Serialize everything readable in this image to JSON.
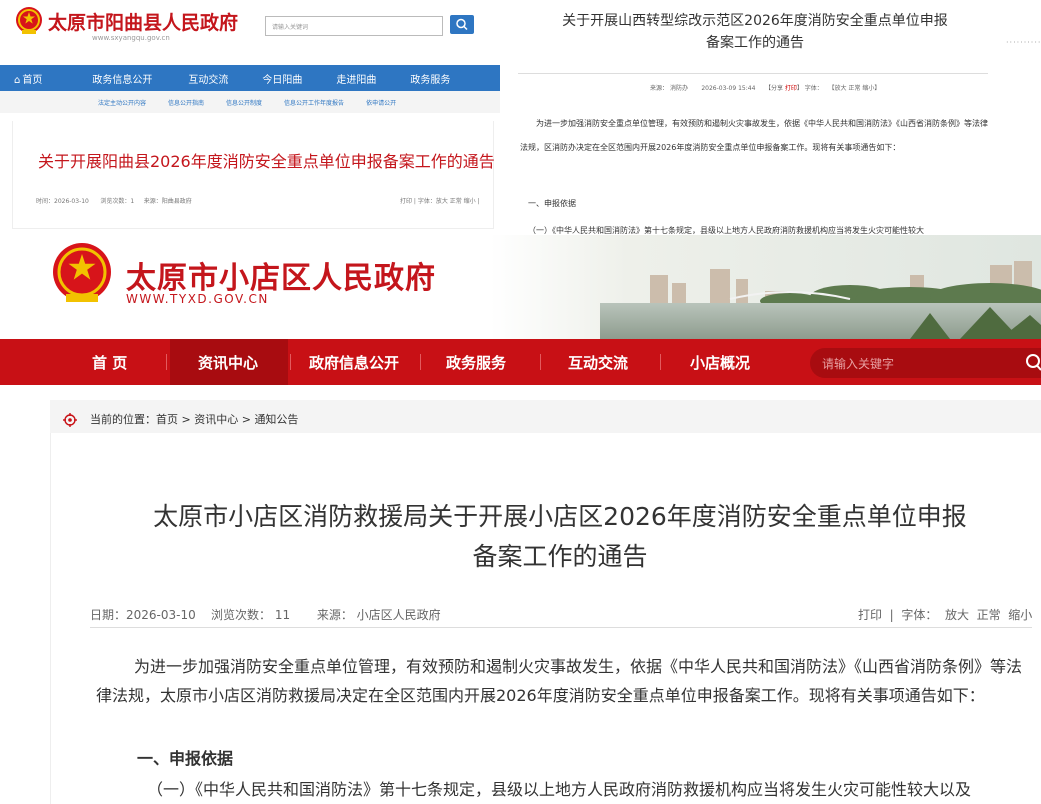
{
  "panelA": {
    "site_title": "太原市阳曲县人民政府",
    "site_url": "www.sxyangqu.gov.cn",
    "search_placeholder": "请输入关键词",
    "nav": [
      "首页",
      "政务信息公开",
      "互动交流",
      "今日阳曲",
      "走进阳曲",
      "政务服务"
    ],
    "subnav": [
      "法定主动公开内容",
      "信息公开指南",
      "信息公开制度",
      "信息公开工作年度报告",
      "依申请公开"
    ],
    "article_title": "关于开展阳曲县2026年度消防安全重点单位申报备案工作的通告",
    "meta": {
      "date": "时间：2026-03-10",
      "views": "浏览次数：1",
      "source": "来源：阳曲县政府"
    },
    "meta_right": "打印 | 字体：放大 正常 缩小 |",
    "colors": {
      "primary": "#2e76c2",
      "title": "#c4161c"
    }
  },
  "panelB": {
    "title_line1": "关于开展山西转型综改示范区2026年度消防安全重点单位申报",
    "title_line2": "备案工作的通告",
    "meta_source": "来源：",
    "meta_source_val": "消防办",
    "meta_date": "2026-03-09 15:44",
    "meta_print": "【分享",
    "meta_print_red": "打印",
    "meta_print_end": "】 字体：",
    "meta_font": "【放大 正常 缩小】",
    "para1": "为进一步加强消防安全重点单位管理，有效预防和遏制火灾事故发生，依据《中华人民共和国消防法》《山西省消防条例》等法律法规，区消防办决定在全区范围内开展2026年度消防安全重点单位申报备案工作。现将有关事项通告如下：",
    "heading1": "一、申报依据",
    "para2": "（一）《中华人民共和国消防法》第十七条规定，县级以上地方人民政府消防救援机构应当将发生火灾可能性较大"
  },
  "panelC": {
    "site_title": "太原市小店区人民政府",
    "site_url": "WWW.TYXD.GOV.CN",
    "nav": [
      "首 页",
      "资讯中心",
      "政府信息公开",
      "政务服务",
      "互动交流",
      "小店概况"
    ],
    "active_nav": "资讯中心",
    "search_placeholder": "请输入关键字",
    "breadcrumb_label": "当前的位置：",
    "breadcrumb": [
      "首页",
      "资讯中心",
      "通知公告"
    ],
    "breadcrumb_sep": " > ",
    "title_line1": "太原市小店区消防救援局关于开展小店区2026年度消防安全重点单位申报",
    "title_line2": "备案工作的通告",
    "meta": {
      "date": "日期：2026-03-10",
      "views": "浏览次数：  11",
      "source": "来源：  小店区人民政府"
    },
    "meta_print": "打印",
    "meta_font_label": "字体：",
    "meta_font_sizes": [
      "放大",
      "正常",
      "缩小"
    ],
    "para1": "为进一步加强消防安全重点单位管理，有效预防和遏制火灾事故发生，依据《中华人民共和国消防法》《山西省消防条例》等法律法规，太原市小店区消防救援局决定在全区范围内开展2026年度消防安全重点单位申报备案工作。现将有关事项通告如下：",
    "heading1": "一、申报依据",
    "para2": "（一）《中华人民共和国消防法》第十七条规定，县级以上地方人民政府消防救援机构应当将发生火灾可能性较大以及",
    "colors": {
      "primary": "#c81015",
      "primary_dark": "#a80c10",
      "title": "#c4161c"
    }
  }
}
